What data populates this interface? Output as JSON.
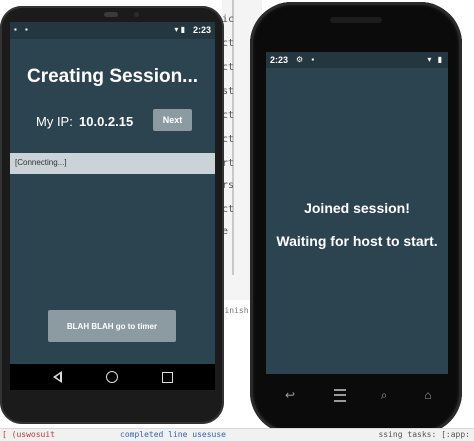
{
  "left_phone": {
    "status_bar": {
      "time": "2:23",
      "notif_icons": "▪ ▪",
      "signal_icons": "▾ ▮"
    },
    "title": "Creating Session...",
    "ip_label": "My IP:",
    "ip_value": "10.0.2.15",
    "next_button": "Next",
    "connecting_text": "[Connecting...]",
    "timer_button": "BLAH BLAH go to timer"
  },
  "right_phone": {
    "status_bar": {
      "time": "2:23",
      "notif_icons": "⚙ ▪",
      "signal_icons": "▾ ▮"
    },
    "joined_text": "Joined session!",
    "waiting_text": "Waiting for host to start."
  },
  "background_ide": {
    "side_fragments": [
      "ic",
      "ct",
      "ct",
      "st",
      "ct",
      "ct",
      "rt",
      "rs",
      "ct",
      "e"
    ],
    "bottom_fragment": "onFinish",
    "footer_left": "[ (uswosuit",
    "footer_mid": "completed line usesuse",
    "footer_right": "ssing tasks: [:app:"
  },
  "colors": {
    "screen_bg": "#2c4450",
    "status_bar_bg": "#223740",
    "button_bg": "#8c9aa1",
    "progress_bg": "#c9d3d8"
  }
}
